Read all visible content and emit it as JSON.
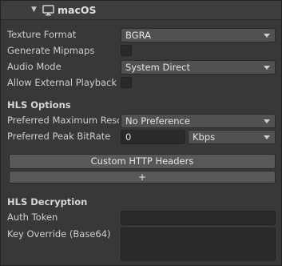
{
  "header": {
    "title": "macOS",
    "collapse_icon": "triangle-down-icon",
    "platform_icon": "monitor-icon"
  },
  "fields": {
    "texture_format": {
      "label": "Texture Format",
      "value": "BGRA"
    },
    "generate_mipmaps": {
      "label": "Generate Mipmaps",
      "checked": false
    },
    "audio_mode": {
      "label": "Audio Mode",
      "value": "System Direct"
    },
    "allow_external_playback": {
      "label": "Allow External Playback",
      "checked": false
    }
  },
  "hls_options": {
    "heading": "HLS Options",
    "preferred_max_resolution": {
      "label": "Preferred Maximum Reso",
      "value": "No Preference"
    },
    "preferred_peak_bitrate": {
      "label": "Preferred Peak BitRate",
      "value": "0",
      "unit": "Kbps"
    },
    "custom_headers_button": "Custom HTTP Headers",
    "add_button": "+"
  },
  "hls_decryption": {
    "heading": "HLS Decryption",
    "auth_token": {
      "label": "Auth Token",
      "value": ""
    },
    "key_override": {
      "label": "Key Override (Base64)",
      "value": ""
    }
  },
  "colors": {
    "background": "#383838",
    "field": "#2a2a2a",
    "dropdown": "#515151",
    "button": "#585858"
  }
}
